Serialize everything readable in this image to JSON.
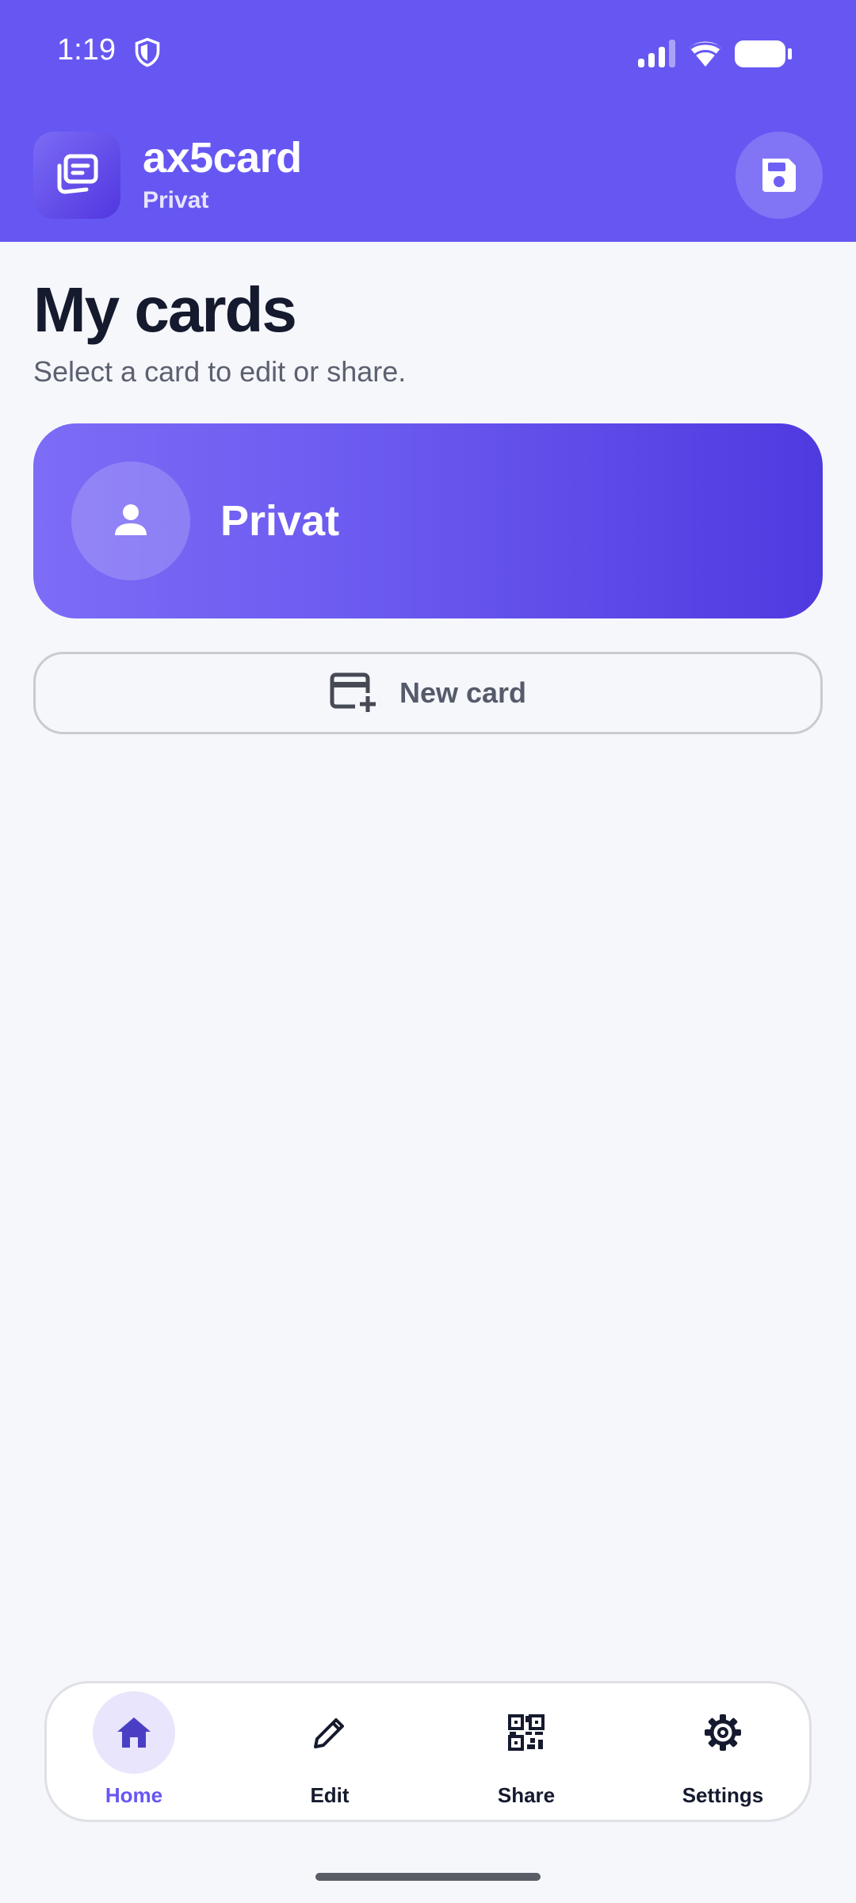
{
  "status_bar": {
    "time": "1:19",
    "icons": [
      "shield-icon",
      "signal-icon",
      "wifi-icon",
      "battery-icon"
    ]
  },
  "header": {
    "app_name": "ax5card",
    "profile": "Privat",
    "logo_icon": "cards-icon",
    "save_icon": "floppy-disk-icon"
  },
  "main": {
    "title": "My cards",
    "subtitle": "Select a card to edit or share.",
    "cards": [
      {
        "name": "Privat",
        "icon": "person-icon"
      }
    ],
    "new_card_label": "New card"
  },
  "bottom_nav": {
    "items": [
      {
        "label": "Home",
        "icon": "home-icon",
        "active": true
      },
      {
        "label": "Edit",
        "icon": "pencil-icon",
        "active": false
      },
      {
        "label": "Share",
        "icon": "qr-code-icon",
        "active": false
      },
      {
        "label": "Settings",
        "icon": "gear-icon",
        "active": false
      }
    ]
  },
  "colors": {
    "accent": "#6657f3",
    "card_gradient_start": "#7c6cf6",
    "card_gradient_end": "#4f3ae0",
    "background": "#f6f7fb",
    "title_text": "#151a2e"
  }
}
